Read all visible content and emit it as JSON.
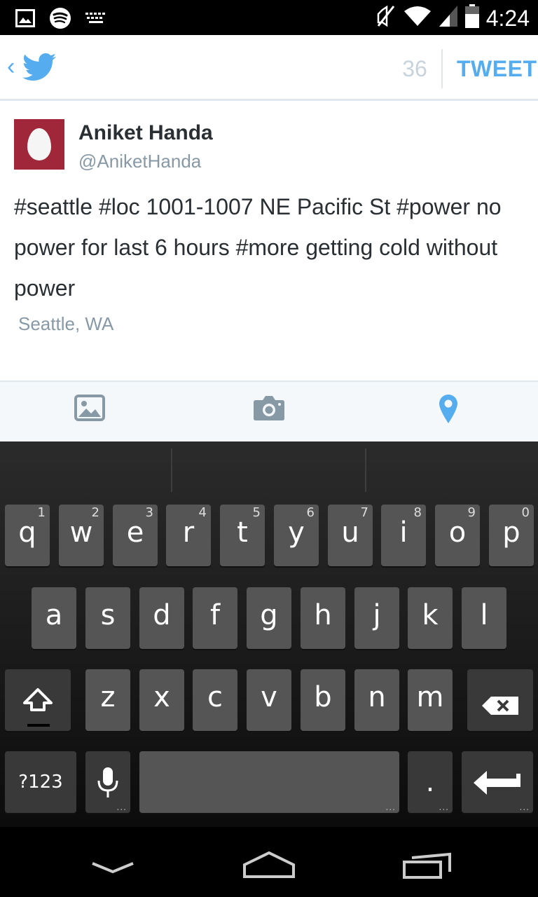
{
  "status_bar": {
    "time": "4:24",
    "icons": [
      "gallery-icon",
      "spotify-icon",
      "keyboard-icon",
      "mute-icon",
      "wifi-icon",
      "signal-icon",
      "battery-icon"
    ]
  },
  "header": {
    "char_count": "36",
    "tweet_label": "TWEET",
    "back_glyph": "‹"
  },
  "compose": {
    "user_name": "Aniket Handa",
    "user_handle": "@AniketHanda",
    "text": "#seattle #loc 1001-1007 NE Pacific St #power no power for last 6 hours #more getting cold without power",
    "location": "Seattle, WA"
  },
  "toolbar": {
    "icons": [
      "gallery-icon",
      "camera-icon",
      "location-pin-icon"
    ],
    "active_color": "#55acee",
    "inactive_color": "#8899a6"
  },
  "keyboard": {
    "row1": [
      {
        "key": "q",
        "hint": "1"
      },
      {
        "key": "w",
        "hint": "2"
      },
      {
        "key": "e",
        "hint": "3"
      },
      {
        "key": "r",
        "hint": "4"
      },
      {
        "key": "t",
        "hint": "5"
      },
      {
        "key": "y",
        "hint": "6"
      },
      {
        "key": "u",
        "hint": "7"
      },
      {
        "key": "i",
        "hint": "8"
      },
      {
        "key": "o",
        "hint": "9"
      },
      {
        "key": "p",
        "hint": "0"
      }
    ],
    "row2": [
      "a",
      "s",
      "d",
      "f",
      "g",
      "h",
      "j",
      "k",
      "l"
    ],
    "row3": [
      "z",
      "x",
      "c",
      "v",
      "b",
      "n",
      "m"
    ],
    "symbols_label": "?123",
    "period_label": ".",
    "dots": "..."
  },
  "nav_bar": {
    "icons": [
      "back-nav-icon",
      "home-nav-icon",
      "recents-nav-icon"
    ]
  }
}
